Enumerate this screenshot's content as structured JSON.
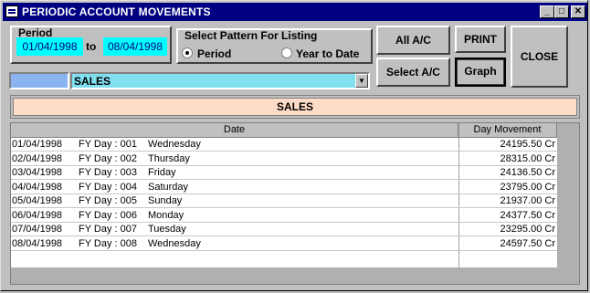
{
  "window": {
    "title": "PERIODIC ACCOUNT MOVEMENTS",
    "controls": {
      "minimize": "_",
      "maximize": "□",
      "close": "✕"
    }
  },
  "period": {
    "label": "Period",
    "from": "01/04/1998",
    "to_label": "to",
    "to": "08/04/1998"
  },
  "pattern": {
    "label": "Select Pattern For Listing",
    "options": [
      "Period",
      "Year to Date"
    ],
    "selected": "Period"
  },
  "buttons": {
    "all_ac": "All A/C",
    "select_ac": "Select A/C",
    "print": "PRINT",
    "graph": "Graph",
    "close": "CLOSE"
  },
  "account": {
    "code": "",
    "name": "SALES",
    "banner": "SALES"
  },
  "table": {
    "columns": [
      "Date",
      "Day Movement"
    ],
    "rows": [
      {
        "date": "01/04/1998",
        "fy": "FY Day : 001",
        "day": "Wednesday",
        "movement": "24195.50 Cr"
      },
      {
        "date": "02/04/1998",
        "fy": "FY Day : 002",
        "day": "Thursday",
        "movement": "28315.00 Cr"
      },
      {
        "date": "03/04/1998",
        "fy": "FY Day : 003",
        "day": "Friday",
        "movement": "24136.50 Cr"
      },
      {
        "date": "04/04/1998",
        "fy": "FY Day : 004",
        "day": "Saturday",
        "movement": "23795.00 Cr"
      },
      {
        "date": "05/04/1998",
        "fy": "FY Day : 005",
        "day": "Sunday",
        "movement": "21937.00 Cr"
      },
      {
        "date": "06/04/1998",
        "fy": "FY Day : 006",
        "day": "Monday",
        "movement": "24377.50 Cr"
      },
      {
        "date": "07/04/1998",
        "fy": "FY Day : 007",
        "day": "Tuesday",
        "movement": "23295.00 Cr"
      },
      {
        "date": "08/04/1998",
        "fy": "FY Day : 008",
        "day": "Wednesday",
        "movement": "24597.50 Cr"
      }
    ]
  },
  "colors": {
    "titlebar": "#000080",
    "date_field": "#00ffff",
    "account_field": "#80e0f0",
    "code_field": "#8ab4f0",
    "banner": "#ffdcc8"
  }
}
